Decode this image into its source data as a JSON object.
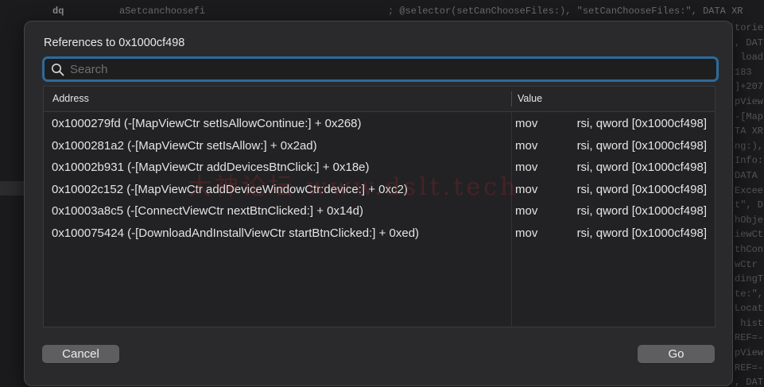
{
  "background": {
    "mnemonic": "dq",
    "label": "aSetcanchoosefi",
    "comment": "; @selector(setCanChooseFiles:), \"setCanChooseFiles:\", DATA XR",
    "right_column": [
      "torie",
      ", DAT",
      " load",
      "183",
      "]+207",
      "pView",
      "-[Map",
      "TA XR",
      "ng:),",
      "Info:",
      "DATA ",
      "Excee",
      "t\", D",
      "hObje",
      "iewCt",
      "thCon",
      "wCtr ",
      "dingT",
      "te:\",",
      "Locat",
      " hist",
      "REF=-",
      "pView",
      "REF=-",
      ", DAT"
    ]
  },
  "dialog": {
    "title": "References to 0x1000cf498",
    "search": {
      "placeholder": "Search",
      "value": ""
    },
    "columns": {
      "address": "Address",
      "value": "Value"
    },
    "rows": [
      {
        "address": "0x1000279fd (-[MapViewCtr setIsAllowContinue:] + 0x268)",
        "mnemonic": "mov",
        "operand": "rsi, qword [0x1000cf498]"
      },
      {
        "address": "0x1000281a2 (-[MapViewCtr setIsAllow:] + 0x2ad)",
        "mnemonic": "mov",
        "operand": "rsi, qword [0x1000cf498]"
      },
      {
        "address": "0x10002b931 (-[MapViewCtr addDevicesBtnClick:] + 0x18e)",
        "mnemonic": "mov",
        "operand": "rsi, qword [0x1000cf498]"
      },
      {
        "address": "0x10002c152 (-[MapViewCtr addDeviceWindowCtr:device:] + 0xc2)",
        "mnemonic": "mov",
        "operand": "rsi, qword [0x1000cf498]"
      },
      {
        "address": "0x10003a8c5 (-[ConnectViewCtr nextBtnClicked:] + 0x14d)",
        "mnemonic": "mov",
        "operand": "rsi, qword [0x1000cf498]"
      },
      {
        "address": "0x100075424 (-[DownloadAndInstallViewCtr startBtnClicked:] + 0xed)",
        "mnemonic": "mov",
        "operand": "rsi, qword [0x1000cf498]"
      }
    ],
    "buttons": {
      "cancel": "Cancel",
      "go": "Go"
    }
  },
  "watermark": "大神论坛 www.dslt.tech"
}
